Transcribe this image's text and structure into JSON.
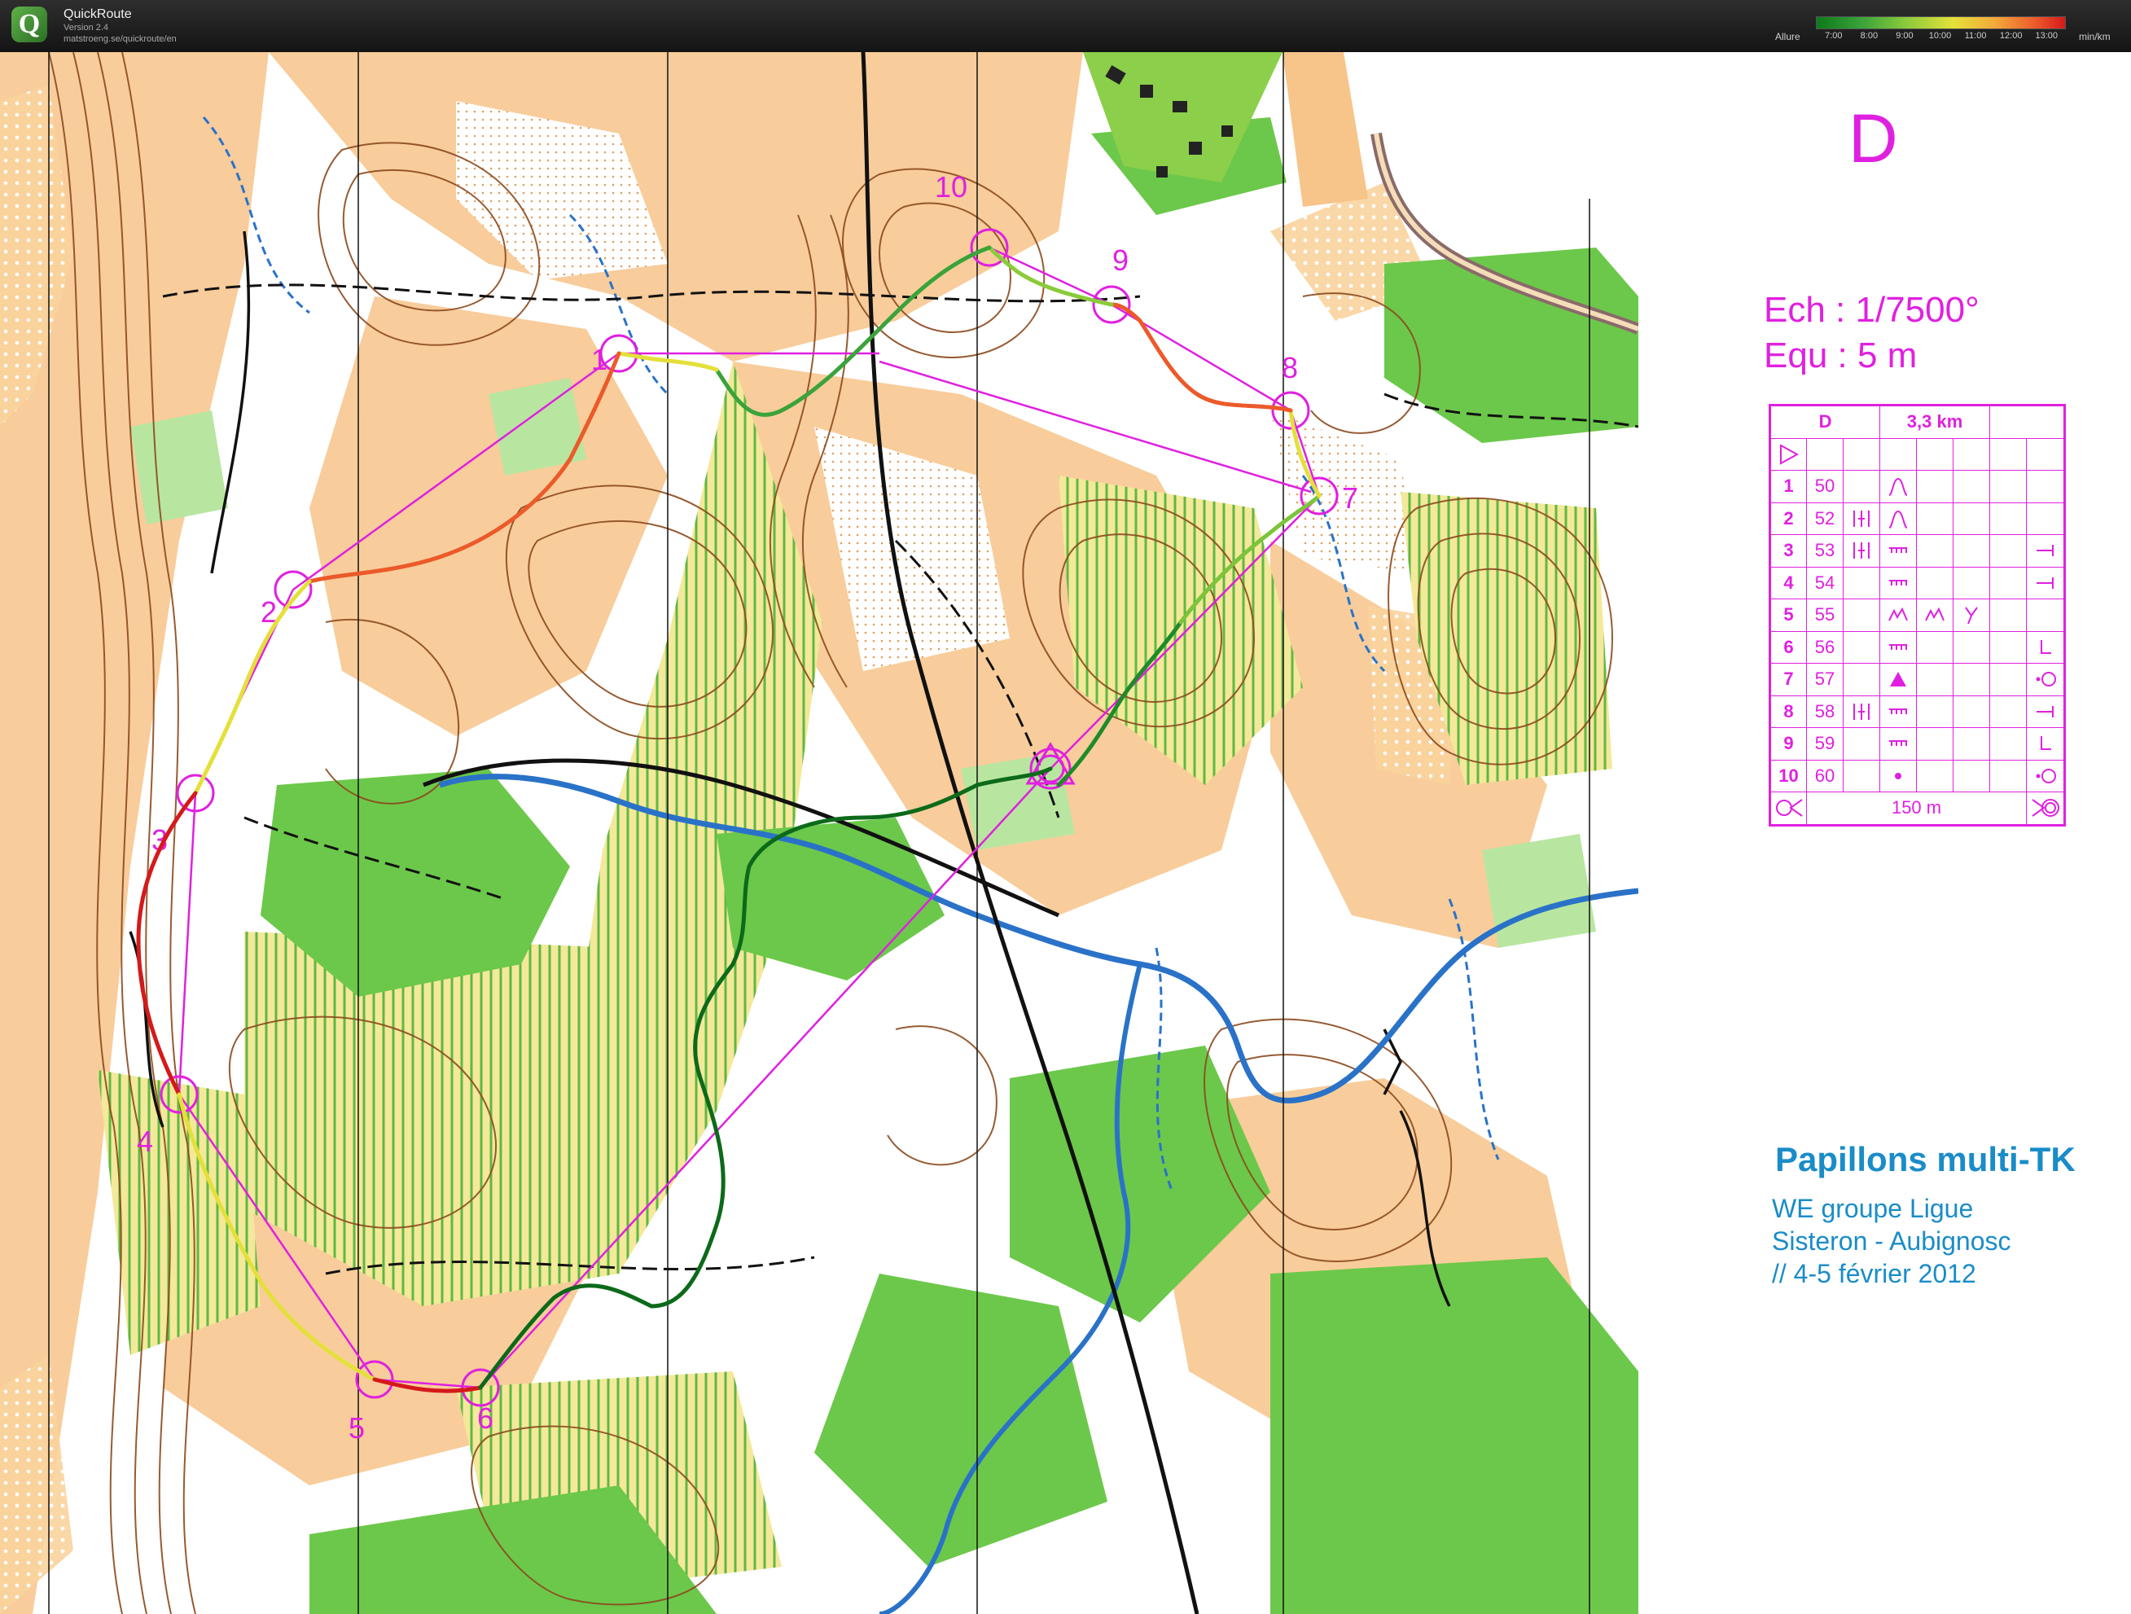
{
  "app": {
    "name": "QuickRoute",
    "version": "Version 2.4",
    "url": "matstroeng.se/quickroute/en",
    "logo_letter": "Q"
  },
  "pace_legend": {
    "label": "Allure",
    "ticks": [
      "7:00",
      "8:00",
      "9:00",
      "10:00",
      "11:00",
      "12:00",
      "13:00"
    ],
    "unit": "min/km"
  },
  "course": {
    "letter": "D",
    "scale": "Ech : 1/7500°",
    "equidistance": "Equ : 5 m",
    "length": "3,3 km",
    "final_distance": "150 m",
    "controls": [
      {
        "num": "1",
        "code": "50"
      },
      {
        "num": "2",
        "code": "52"
      },
      {
        "num": "3",
        "code": "53"
      },
      {
        "num": "4",
        "code": "54"
      },
      {
        "num": "5",
        "code": "55"
      },
      {
        "num": "6",
        "code": "56"
      },
      {
        "num": "7",
        "code": "57"
      },
      {
        "num": "8",
        "code": "58"
      },
      {
        "num": "9",
        "code": "59"
      },
      {
        "num": "10",
        "code": "60"
      }
    ]
  },
  "map_labels": {
    "c1": "1",
    "c2": "2",
    "c3": "3",
    "c4": "4",
    "c5": "5",
    "c6": "6",
    "c7": "7",
    "c8": "8",
    "c9": "9",
    "c10": "10"
  },
  "event": {
    "title": "Papillons multi-TK",
    "line1": "WE groupe Ligue",
    "line2": "Sisteron - Aubignosc",
    "line3": "// 4-5 février 2012"
  },
  "colors": {
    "course_overprint": "#e020e0",
    "event_text": "#1a8cc8",
    "contour": "#8b4a1e",
    "open_land": "#f7c48a",
    "forest_green": "#6cc84a",
    "water": "#2a72c8"
  }
}
